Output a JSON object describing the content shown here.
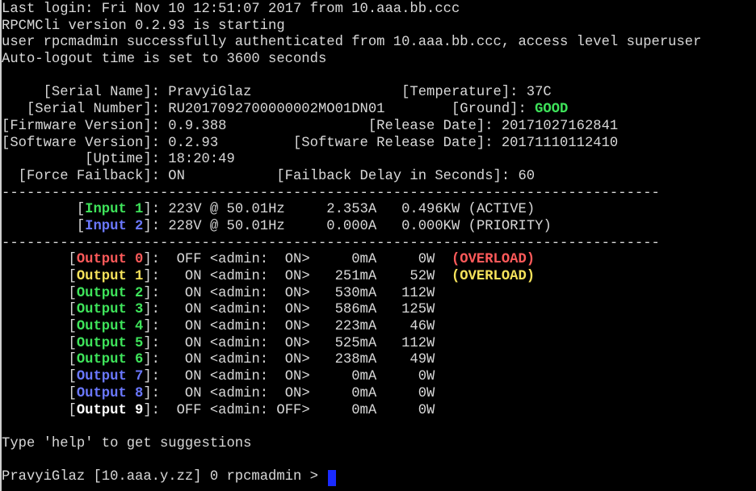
{
  "colors": {
    "text": "#d8d8d8",
    "good": "#3ee35a",
    "input1": "#3ee35a",
    "input2": "#6a78ff",
    "overload": "#ff5a5a",
    "output0": "#ff5a5a",
    "output1": "#f5e25b",
    "green_out": "#3ee35a",
    "blue_out": "#6a78ff",
    "white_out": "#ffffff",
    "cursor": "#1a2bff"
  },
  "header": {
    "login": "Last login: Fri Nov 10 12:51:07 2017 from 10.aaa.bb.ccc",
    "version": "RPCMCli version 0.2.93 is starting",
    "auth": "user rpcmadmin successfully authenticated from 10.aaa.bb.ccc, access level superuser",
    "autologout": "Auto-logout time is set to 3600 seconds"
  },
  "info": {
    "serial_name_row": "     [Serial Name]: PravyiGlaz                  [Temperature]: 37C",
    "serial_number_row_prefix": "   [Serial Number]: RU2017092700000002MO01DN01        [Ground]: ",
    "ground_value": "GOOD",
    "firmware_row": "[Firmware Version]: 0.9.388                 [Release Date]: 20171027162841",
    "software_row": "[Software Version]: 0.2.93         [Software Release Date]: 20171110112410",
    "uptime_row": "          [Uptime]: 18:20:49",
    "failback_row": "  [Force Failback]: ON           [Failback Delay in Seconds]: 60"
  },
  "separator": "-------------------------------------------------------------------------------",
  "inputs": [
    {
      "indent": "         ",
      "label": "Input 1",
      "rest": ": 223V @ 50.01Hz     2.353A   0.496KW (ACTIVE)"
    },
    {
      "indent": "         ",
      "label": "Input 2",
      "rest": ": 228V @ 50.01Hz     0.000A   0.000KW (PRIORITY)"
    }
  ],
  "outputs": [
    {
      "label": "Output 0",
      "rest": ":  OFF <admin:  ON>     0mA     0W  ",
      "warning": "(OVERLOAD)"
    },
    {
      "label": "Output 1",
      "rest": ":   ON <admin:  ON>   251mA    52W  ",
      "warning": "(OVERLOAD)"
    },
    {
      "label": "Output 2",
      "rest": ":   ON <admin:  ON>   530mA   112W",
      "warning": ""
    },
    {
      "label": "Output 3",
      "rest": ":   ON <admin:  ON>   586mA   125W",
      "warning": ""
    },
    {
      "label": "Output 4",
      "rest": ":   ON <admin:  ON>   223mA    46W",
      "warning": ""
    },
    {
      "label": "Output 5",
      "rest": ":   ON <admin:  ON>   525mA   112W",
      "warning": ""
    },
    {
      "label": "Output 6",
      "rest": ":   ON <admin:  ON>   238mA    49W",
      "warning": ""
    },
    {
      "label": "Output 7",
      "rest": ":   ON <admin:  ON>     0mA     0W",
      "warning": ""
    },
    {
      "label": "Output 8",
      "rest": ":   ON <admin:  ON>     0mA     0W",
      "warning": ""
    },
    {
      "label": "Output 9",
      "rest": ":  OFF <admin: OFF>     0mA     0W",
      "warning": ""
    }
  ],
  "help_text": "Type 'help' to get suggestions",
  "prompt": "PravyiGlaz [10.aaa.y.zz] 0 rpcmadmin > "
}
